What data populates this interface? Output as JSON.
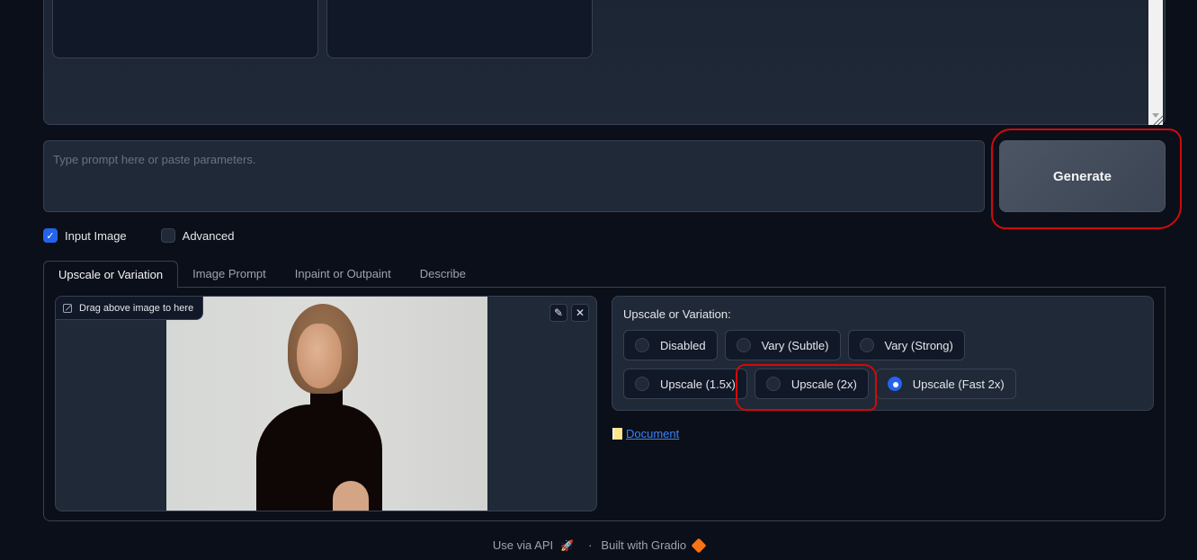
{
  "prompt": {
    "placeholder": "Type prompt here or paste parameters.",
    "value": ""
  },
  "generate_button": {
    "label": "Generate"
  },
  "options": {
    "input_image": {
      "label": "Input Image",
      "checked": true
    },
    "advanced": {
      "label": "Advanced",
      "checked": false
    }
  },
  "tabs": [
    {
      "label": "Upscale or Variation",
      "active": true
    },
    {
      "label": "Image Prompt",
      "active": false
    },
    {
      "label": "Inpaint or Outpaint",
      "active": false
    },
    {
      "label": "Describe",
      "active": false
    }
  ],
  "image_input": {
    "label": "Drag above image to here",
    "edit_icon": "pencil-icon",
    "clear_icon": "close-icon"
  },
  "upscale_variation": {
    "title": "Upscale or Variation:",
    "options": [
      {
        "label": "Disabled",
        "selected": false
      },
      {
        "label": "Vary (Subtle)",
        "selected": false
      },
      {
        "label": "Vary (Strong)",
        "selected": false
      },
      {
        "label": "Upscale (1.5x)",
        "selected": false
      },
      {
        "label": "Upscale (2x)",
        "selected": false
      },
      {
        "label": "Upscale (Fast 2x)",
        "selected": true
      }
    ]
  },
  "document_link": {
    "icon": "📜",
    "label": "Document"
  },
  "footer": {
    "api_label": "Use via API",
    "separator": "·",
    "built_with": "Built with Gradio"
  },
  "colors": {
    "background": "#0b0f19",
    "panel": "#1f2937",
    "border": "#374151",
    "accent": "#2563eb",
    "link": "#3b82f6",
    "annotation": "#d10a0a"
  }
}
